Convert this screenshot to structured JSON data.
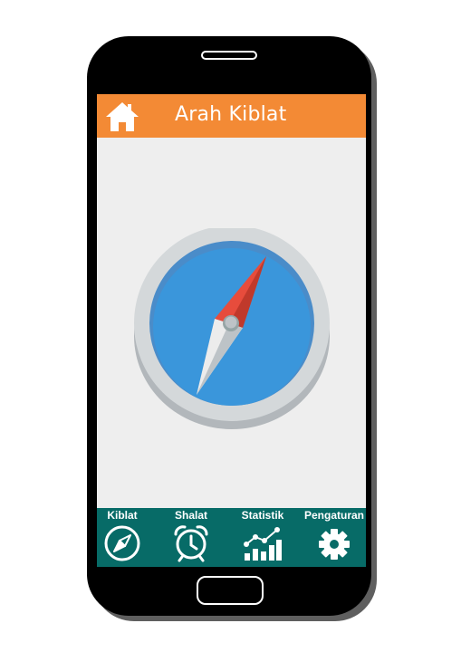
{
  "app": {
    "title": "Arah Kiblat",
    "header_color": "#f38a35",
    "nav_color": "#076b67",
    "home_icon": "home-icon",
    "main_icon": "compass-icon"
  },
  "nav": {
    "items": [
      {
        "label": "Kiblat",
        "icon": "compass-icon"
      },
      {
        "label": "Shalat",
        "icon": "alarm-clock-icon"
      },
      {
        "label": "Statistik",
        "icon": "bar-chart-icon"
      },
      {
        "label": "Pengaturan",
        "icon": "gear-icon"
      }
    ]
  }
}
